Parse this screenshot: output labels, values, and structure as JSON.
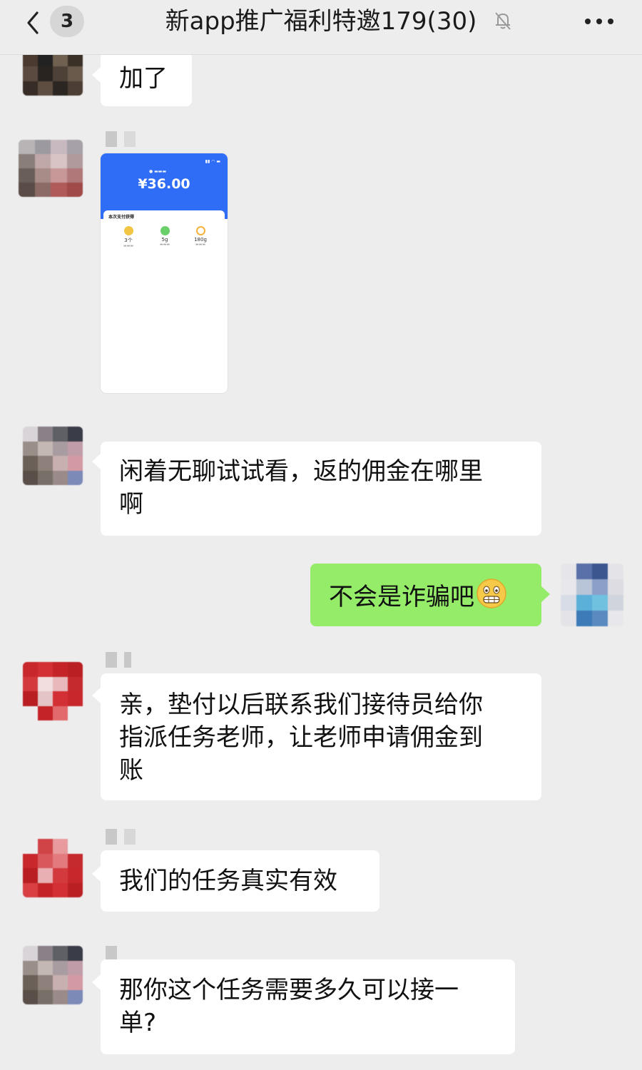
{
  "header": {
    "back_count": "3",
    "title": "新app推广福利特邀179(30)"
  },
  "screenshot": {
    "amount": "¥36.00",
    "card_title": "本次支付获得",
    "items": [
      {
        "value": "3个",
        "color": "#f3c545"
      },
      {
        "value": "5g",
        "color": "#6bd06a"
      },
      {
        "value": "180g",
        "color": "#f5b23a"
      }
    ]
  },
  "messages": {
    "m1": "加了",
    "m3_line1": "闲着无聊试试看，返的佣金在哪里",
    "m3_line2": "啊",
    "m4": "不会是诈骗吧",
    "m5_line1": "亲，垫付以后联系我们接待员给你",
    "m5_line2": "指派任务老师，让老师申请佣金到",
    "m5_line3": "账",
    "m6": "我们的任务真实有效",
    "m7_line1": "那你这个任务需要多久可以接一",
    "m7_line2": "单?"
  },
  "icons": {
    "back": "chevron-left-icon",
    "mute": "bell-off-icon",
    "more": "more-dots-icon",
    "emoji": "grimace-emoji-icon"
  }
}
